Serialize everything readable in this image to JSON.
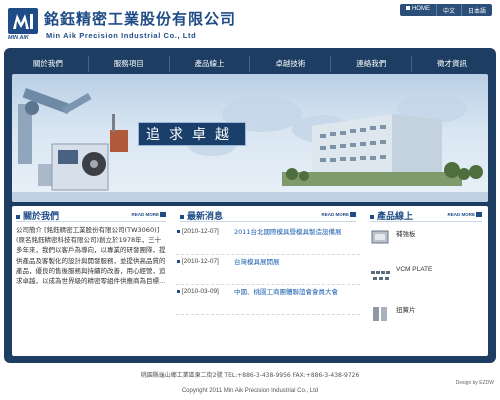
{
  "header": {
    "company_cn": "銘鈺精密工業股份有限公司",
    "company_en": "Min Aik Precision Industrial Co., Ltd",
    "logo_text": "MIN AIK",
    "top_links": [
      {
        "label": "HOME"
      },
      {
        "label": "中文"
      },
      {
        "label": "日本語"
      }
    ]
  },
  "nav": {
    "items": [
      {
        "label": "關於我們"
      },
      {
        "label": "服務項目"
      },
      {
        "label": "產品線上"
      },
      {
        "label": "卓越技術"
      },
      {
        "label": "連絡我們"
      },
      {
        "label": "徵才資訊"
      }
    ]
  },
  "banner": {
    "slogan": "追求卓越"
  },
  "about": {
    "title": "關於我們",
    "more": "READ MORE",
    "text": "公司簡介 [銘鈺精密工業股份有限公司(TW3060)](原名銘鈺精密科技有限公司)創立於1978年，三十多年來，我們以客戶為導向，以專業的研發團隊，提供產品及客製化的設計與開發服務，並提供高品質的產品，優良的售後服務與持續的改善，用心經營，追求卓越，以成為世界級的精密零組件供應商為目標..."
  },
  "news": {
    "title": "最新消息",
    "more": "READ MORE",
    "items": [
      {
        "date": "[2010-12-07]",
        "title": "2011台北國際模具暨模具製造設備展"
      },
      {
        "date": "[2010-12-07]",
        "title": "台灣模具展開展"
      },
      {
        "date": "[2010-03-09]",
        "title": "中國、桃園工商團體聯誼會會員大會"
      }
    ]
  },
  "products": {
    "title": "產品線上",
    "more": "READ MORE",
    "items": [
      {
        "name": "補強板"
      },
      {
        "name": "VCM PLATE"
      },
      {
        "name": "扭簧片"
      }
    ]
  },
  "footer": {
    "address": "桃園縣龜山鄉工業區東二街2號 TEL:+886-3-438-9956 FAX:+886-3-438-9726",
    "copyright": "Copyright 2011 Min Aik Precision Industrial Co., Ltd",
    "design": "Design by EZDW"
  },
  "colors": {
    "brand": "#1f4c86",
    "frame": "#1d3d63",
    "link": "#1a5fb0"
  }
}
